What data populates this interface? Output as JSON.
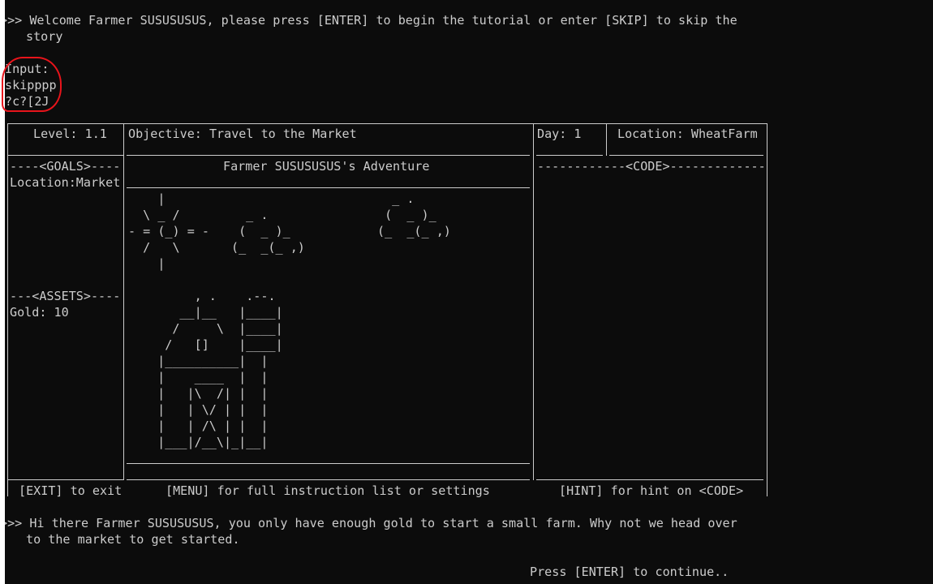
{
  "intro": {
    "line1": ">>> Welcome Farmer SUSUSUSUS, please press [ENTER] to begin the tutorial or enter [SKIP] to skip the",
    "line2": "story"
  },
  "input_block": {
    "label": "Input:",
    "value": "skipppp",
    "escape_residue": "?c?[2J"
  },
  "status_bar": {
    "level": "Level: 1.1",
    "objective": "Objective: Travel to the Market",
    "day": "Day: 1",
    "location": "Location: WheatFarm"
  },
  "left_panel": {
    "goals_header": "----<GOALS>----",
    "goal_item": "Location:Market",
    "assets_header": "---<ASSETS>----",
    "gold": "Gold: 10"
  },
  "center_panel": {
    "title": "Farmer SUSUSUSUS's Adventure",
    "sun_art": "    |\n  \\ _ /\n- = (_) = -\n  /   \\\n    |",
    "cloud1_art": "  _ .\n (  _ )_\n(_  _(_ ,)",
    "cloud2_art": "  _ .\n (  _ )_\n(_  _(_ ,)",
    "building_art": "       , .    .--.\n     __|__   |____|\n    /     \\  |____|\n   /   []    |____|\n  |__________|  |\n  |    ____  |  |\n  |   |\\  /| |  |\n  |   | \\/ | |  |\n  |   | /\\ | |  |\n  |___|/__\\|_|__|"
  },
  "right_panel": {
    "code_header": "------------<CODE>-------------"
  },
  "footer_bar": {
    "exit": "[EXIT] to exit",
    "menu": "[MENU] for full instruction list or settings",
    "hint": "[HINT] for hint on <CODE>"
  },
  "message": {
    "line1": ">>> Hi there Farmer SUSUSUSUS, you only have enough gold to start a small farm. Why not we head over",
    "line2": "to the market to get started."
  },
  "prompt": {
    "continue": "Press [ENTER] to continue.."
  },
  "colors": {
    "terminal_bg": "#0c0c0c",
    "terminal_fg": "#cccccc",
    "annotation": "#e8141b"
  }
}
